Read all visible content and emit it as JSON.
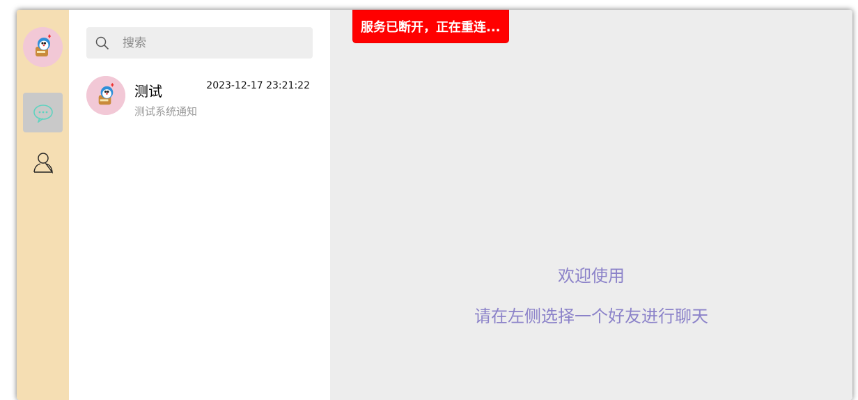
{
  "rail": {
    "avatar_icon": "doraemon-avatar",
    "chat_icon": "chat-bubble-icon",
    "contacts_icon": "user-icon",
    "chat_icon_color": "#5fd3c0",
    "rail_color": "#f5deb3"
  },
  "search": {
    "placeholder": "搜索",
    "value": ""
  },
  "conversations": [
    {
      "name": "测试",
      "time": "2023-12-17 23:21:22",
      "preview": "测试系统通知"
    }
  ],
  "main": {
    "toast": "服务已断开，正在重连...",
    "toast_color": "#ff0000",
    "welcome": "欢迎使用",
    "hint": "请在左侧选择一个好友进行聊天",
    "text_color": "#8b82c9"
  }
}
